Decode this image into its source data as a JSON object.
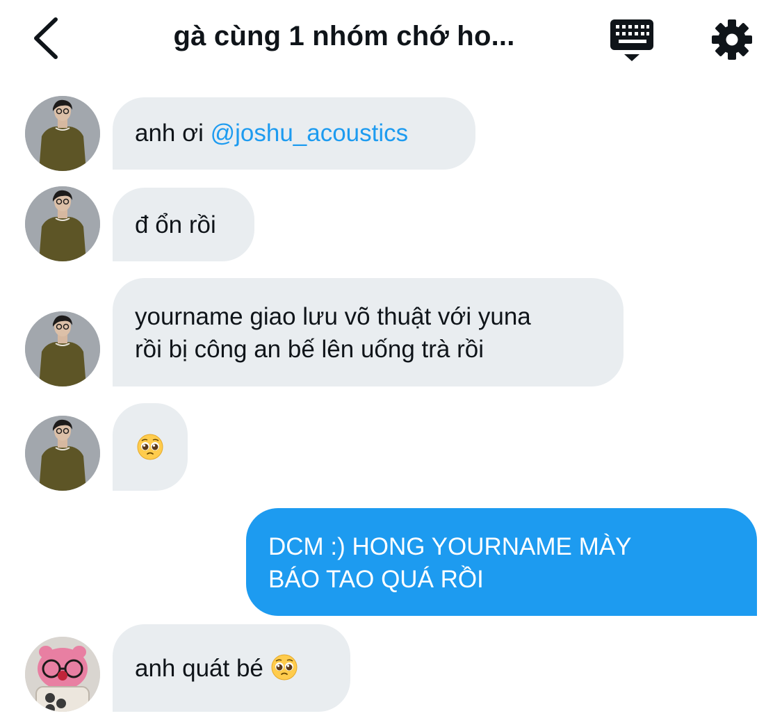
{
  "header": {
    "title": "gà cùng 1 nhóm chớ ho...",
    "icons": {
      "back": "chevron-left-icon",
      "keyboard": "keyboard-icon",
      "settings": "gear-icon"
    }
  },
  "colors": {
    "accent": "#1d9bf0",
    "bubble_in": "#e9edf0",
    "text": "#0f1419"
  },
  "messages": [
    {
      "direction": "incoming",
      "sender_avatar": "avatar-man-olive-shirt",
      "text": "anh ơi ",
      "mention": "@joshu_acoustics"
    },
    {
      "direction": "incoming",
      "sender_avatar": "avatar-man-olive-shirt",
      "text": "đ ổn rồi"
    },
    {
      "direction": "incoming",
      "sender_avatar": "avatar-man-olive-shirt",
      "line1": "yourname giao lưu võ thuật với yuna",
      "line2": "rồi bị công an bế lên uống trà rồi"
    },
    {
      "direction": "incoming",
      "sender_avatar": "avatar-man-olive-shirt",
      "emoji": "🥺"
    },
    {
      "direction": "outgoing",
      "line1": "DCM :) HONG YOURNAME MÀY",
      "line2": "BÁO TAO QUÁ RỒI"
    },
    {
      "direction": "incoming",
      "sender_avatar": "avatar-pink-plush-glasses",
      "text": "anh quát bé ",
      "emoji": "🥺"
    }
  ]
}
